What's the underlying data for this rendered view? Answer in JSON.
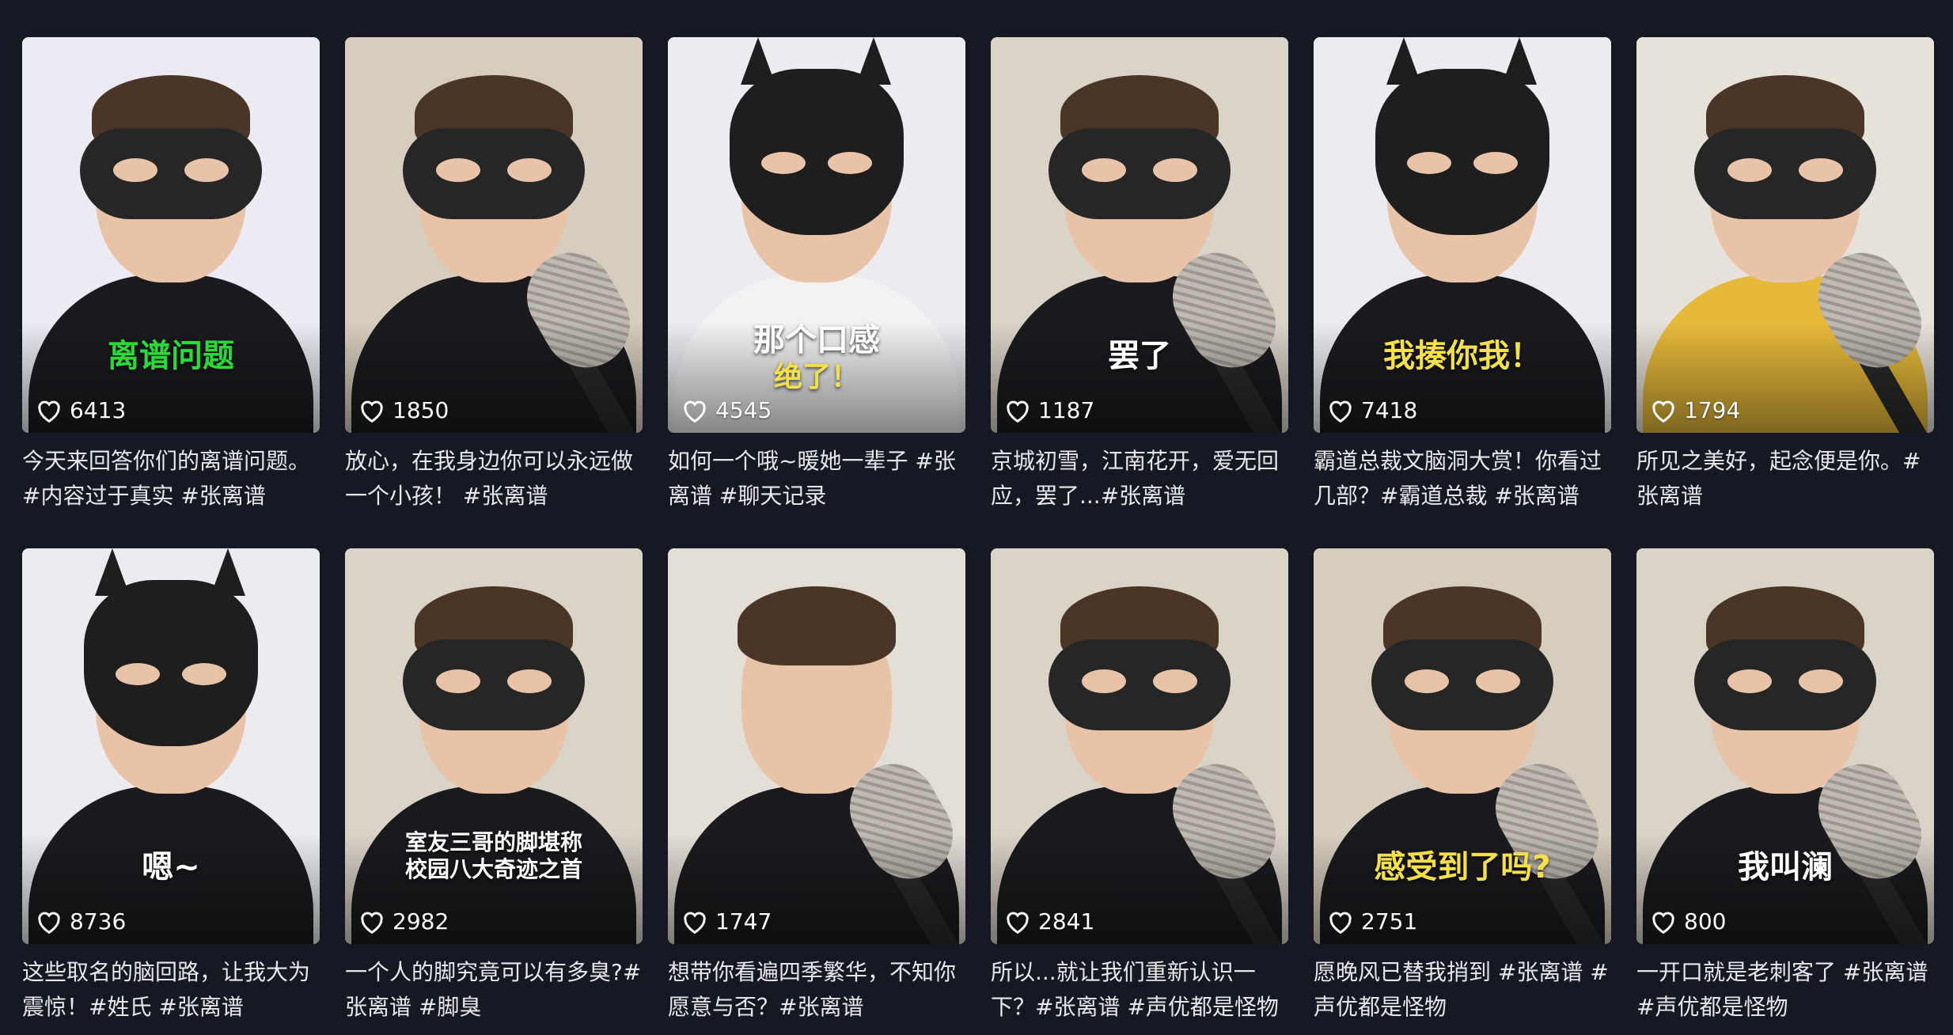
{
  "videos": [
    {
      "likes": "6413",
      "caption": "今天来回答你们的离谱问题。#内容过于真实 #张离谱",
      "overlay": "离谱问题",
      "overlay_color": "#2bd93b",
      "bg": "#eceaf2",
      "shirt": "#1b1b1f",
      "mask": "mask",
      "mic": false
    },
    {
      "likes": "1850",
      "caption": "放心，在我身边你可以永远做一个小孩！ #张离谱",
      "overlay": "",
      "overlay_color": "#ffffff",
      "bg": "#d7cdbf",
      "shirt": "#1b1b1f",
      "mask": "mask",
      "mic": true
    },
    {
      "likes": "4545",
      "caption": "如何一个哦~暖她一辈子 #张离谱 #聊天记录",
      "overlay": "那个口感",
      "overlay2": "绝了！",
      "overlay_color": "#ffffff",
      "overlay2_color": "#f4e04d",
      "bg": "#ecebf0",
      "shirt": "#f2f2f2",
      "mask": "cowl",
      "mic": false
    },
    {
      "likes": "1187",
      "caption": "京城初雪，江南花开，爱无回应，罢了...#张离谱",
      "overlay": "罢了",
      "overlay_color": "#ffffff",
      "bg": "#d9d3c8",
      "shirt": "#1b1b1f",
      "mask": "mask",
      "mic": true
    },
    {
      "likes": "7418",
      "caption": "霸道总裁文脑洞大赏！你看过几部？#霸道总裁 #张离谱",
      "overlay": "我揍你我！",
      "overlay_color": "#f4e04d",
      "bg": "#ecebf0",
      "shirt": "#1b1b1f",
      "mask": "cowl",
      "mic": false
    },
    {
      "likes": "1794",
      "caption": "所见之美好，起念便是你。#张离谱",
      "overlay": "",
      "overlay_color": "#ffffff",
      "bg": "#e6e1d9",
      "shirt": "#e6b93a",
      "mask": "mask",
      "mic": true
    },
    {
      "likes": "8736",
      "caption": "这些取名的脑回路，让我大为震惊！#姓氏 #张离谱",
      "overlay": "嗯~",
      "overlay_color": "#ffffff",
      "bg": "#ecebf0",
      "shirt": "#1b1b1f",
      "mask": "cowl",
      "mic": false
    },
    {
      "likes": "2982",
      "caption": "一个人的脚究竟可以有多臭?#张离谱 #脚臭",
      "overlay": "室友三哥的脚堪称",
      "overlay2": "校园八大奇迹之首",
      "overlay_color": "#ffffff",
      "overlay2_color": "#ffffff",
      "bg": "#d9d3c8",
      "shirt": "#1b1b1f",
      "mask": "mask",
      "mic": false
    },
    {
      "likes": "1747",
      "caption": "想带你看遍四季繁华，不知你愿意与否？#张离谱",
      "overlay": "",
      "overlay_color": "#ffffff",
      "bg": "#e3ded6",
      "shirt": "#1b1b1f",
      "mask": "none",
      "mic": true
    },
    {
      "likes": "2841",
      "caption": "所以...就让我们重新认识一下？#张离谱 #声优都是怪物",
      "overlay": "",
      "overlay_color": "#ffffff",
      "bg": "#d9d3c8",
      "shirt": "#1b1b1f",
      "mask": "mask",
      "mic": true
    },
    {
      "likes": "2751",
      "caption": "愿晚风已替我捎到 #张离谱 #声优都是怪物",
      "overlay": "感受到了吗?",
      "overlay_color": "#f4e04d",
      "bg": "#d7cdbf",
      "shirt": "#1b1b1f",
      "mask": "mask",
      "mic": true
    },
    {
      "likes": "800",
      "caption": "一开口就是老刺客了 #张离谱 #声优都是怪物",
      "overlay": "我叫澜",
      "overlay_color": "#ffffff",
      "bg": "#d9d3c8",
      "shirt": "#1b1b1f",
      "mask": "mask",
      "mic": true
    }
  ]
}
